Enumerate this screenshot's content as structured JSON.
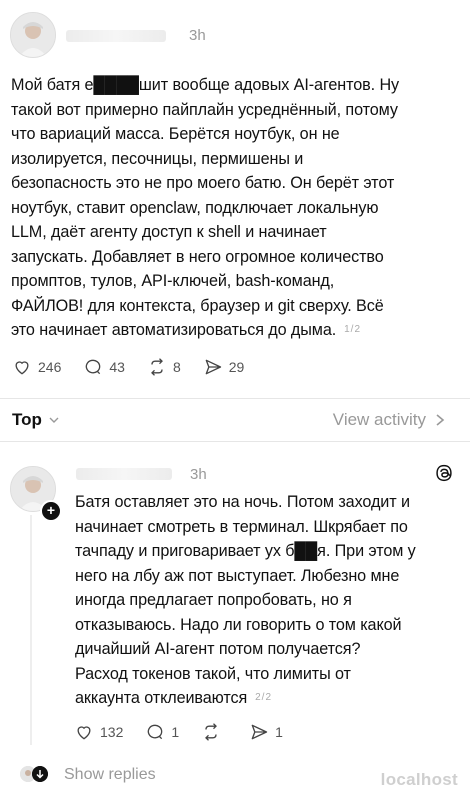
{
  "post1": {
    "time": "3h",
    "text": "Мой батя е████шит вообще адовых AI-агентов. Ну\nтакой вот примерно пайплайн усреднённый, потому\nчто вариаций масса. Берётся ноутбук, он не\nизолируется, песочницы, пермишены и\nбезопасность это не про моего батю. Он берёт этот\nноутбук, ставит openclaw, подключает локальную\nLLM, даёт агенту доступ к shell и начинает\nзапускать. Добавляет в него огромное количество\nпромптов, тулов, API-ключей, bash-команд,\nФАЙЛОВ! для контекста, браузер и git сверху. Всё\nэто начинает автоматизироваться до дыма.",
    "pager": "1/2",
    "likes": "246",
    "comments": "43",
    "reposts": "8",
    "shares": "29"
  },
  "sort": {
    "label": "Top",
    "view_activity": "View activity"
  },
  "post2": {
    "time": "3h",
    "text": "Батя оставляет это на ночь. Потом заходит и\nначинает смотреть в терминал. Шкрябает по\nтачпаду и приговаривает ух б██я. При этом у\nнего на лбу аж пот выступает. Любезно мне\nиногда предлагает попробовать, но я\nотказываюсь. Надо ли говорить о том какой\nдичайший AI-агент потом получается?\nРасход токенов такой, что лимиты от\nаккаунта отклеиваются",
    "pager": "2/2",
    "likes": "132",
    "comments": "1",
    "reposts": "",
    "shares": "1"
  },
  "show_replies": "Show replies",
  "watermark": "localhost",
  "icons": {
    "like": "heart-icon",
    "comment": "comment-bubble-icon",
    "repost": "repost-icon",
    "share": "send-icon",
    "threads": "threads-logo-icon"
  }
}
